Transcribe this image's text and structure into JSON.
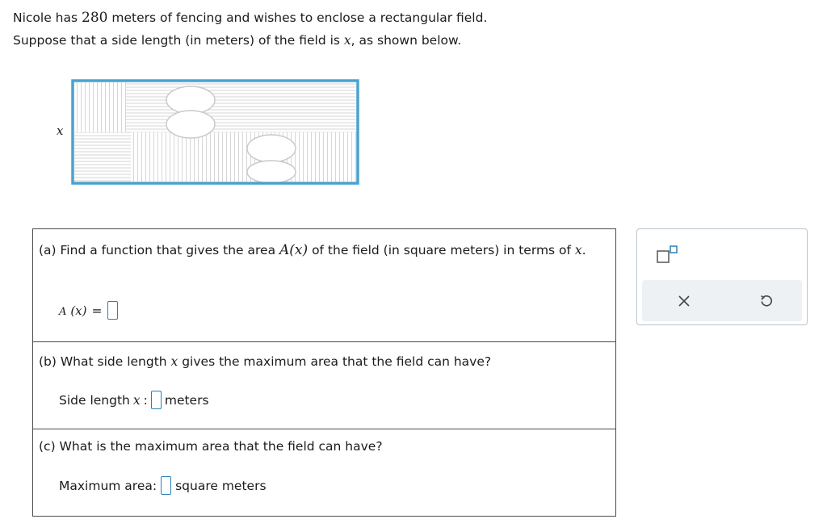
{
  "problem": {
    "line1_before": "Nicole has ",
    "fence_length": "280",
    "line1_after": " meters of fencing and wishes to enclose a rectangular field.",
    "line2_before": "Suppose that a side length (in meters) of the field is ",
    "variable": "x",
    "line2_after": ", as shown below."
  },
  "figure": {
    "side_label": "x",
    "border_color": "#4aa3cf"
  },
  "part_a": {
    "text_before": "(a) Find a function that gives the area ",
    "func_name": "A",
    "func_arg": "(x)",
    "text_middle": " of the field (in square meters) in terms of ",
    "var": "x",
    "text_after": ".",
    "answer_func": "A",
    "answer_arg": "(x)",
    "equals": "="
  },
  "part_b": {
    "text_before": "(b) What side length ",
    "var": "x",
    "text_after": " gives the maximum area that the field can have?",
    "answer_label": "Side length ",
    "answer_var": "x",
    "colon": " :",
    "unit": "meters"
  },
  "part_c": {
    "text": "(c) What is the maximum area that the field can have?",
    "answer_label": "Maximum area:",
    "unit": "square meters"
  },
  "toolbar": {
    "superscript_icon": "superscript-template-icon",
    "clear_icon": "x-icon",
    "undo_icon": "undo-icon",
    "accent_color": "#2a7fb8"
  }
}
